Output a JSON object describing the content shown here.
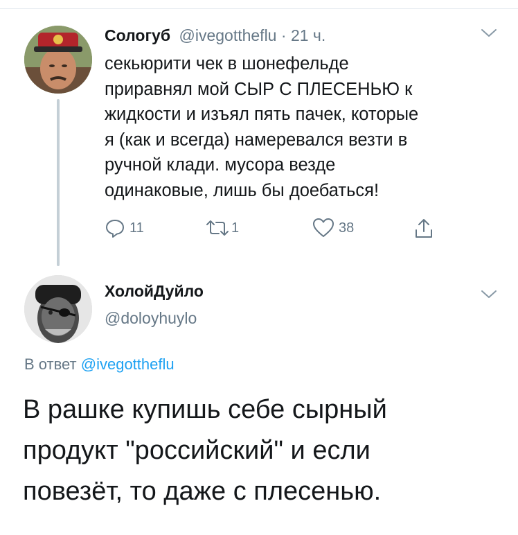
{
  "tweet1": {
    "name": "Сологуб",
    "handle": "@ivegottheflu",
    "separator": " · ",
    "time": "21 ч.",
    "text_lines": [
      "секьюрити чек в шонефельде",
      "приравнял мой СЫР С ПЛЕСЕНЬЮ к",
      "жидкости и изъял пять пачек, которые",
      "я (как и всегда) намеревался везти в",
      "ручной клади. мусора везде",
      "одинаковые, лишь бы доебаться!"
    ],
    "actions": {
      "replies": "11",
      "retweets": "1",
      "likes": "38"
    }
  },
  "tweet2": {
    "name": "ХолойДуйло",
    "handle": "@doloyhuylo",
    "reply_prefix": "В ответ ",
    "reply_mention": "@ivegottheflu",
    "text_lines": [
      "В рашке купишь себе сырный",
      "продукт \"российский\" и если",
      "повезёт, то даже с плесенью."
    ]
  },
  "colors": {
    "accent": "#1da1f2",
    "secondary_text": "#657786",
    "primary_text": "#14171a",
    "thread_line": "#c4cfd6"
  },
  "icons": [
    "chevron-down-icon",
    "reply-icon",
    "retweet-icon",
    "like-icon",
    "share-icon"
  ]
}
